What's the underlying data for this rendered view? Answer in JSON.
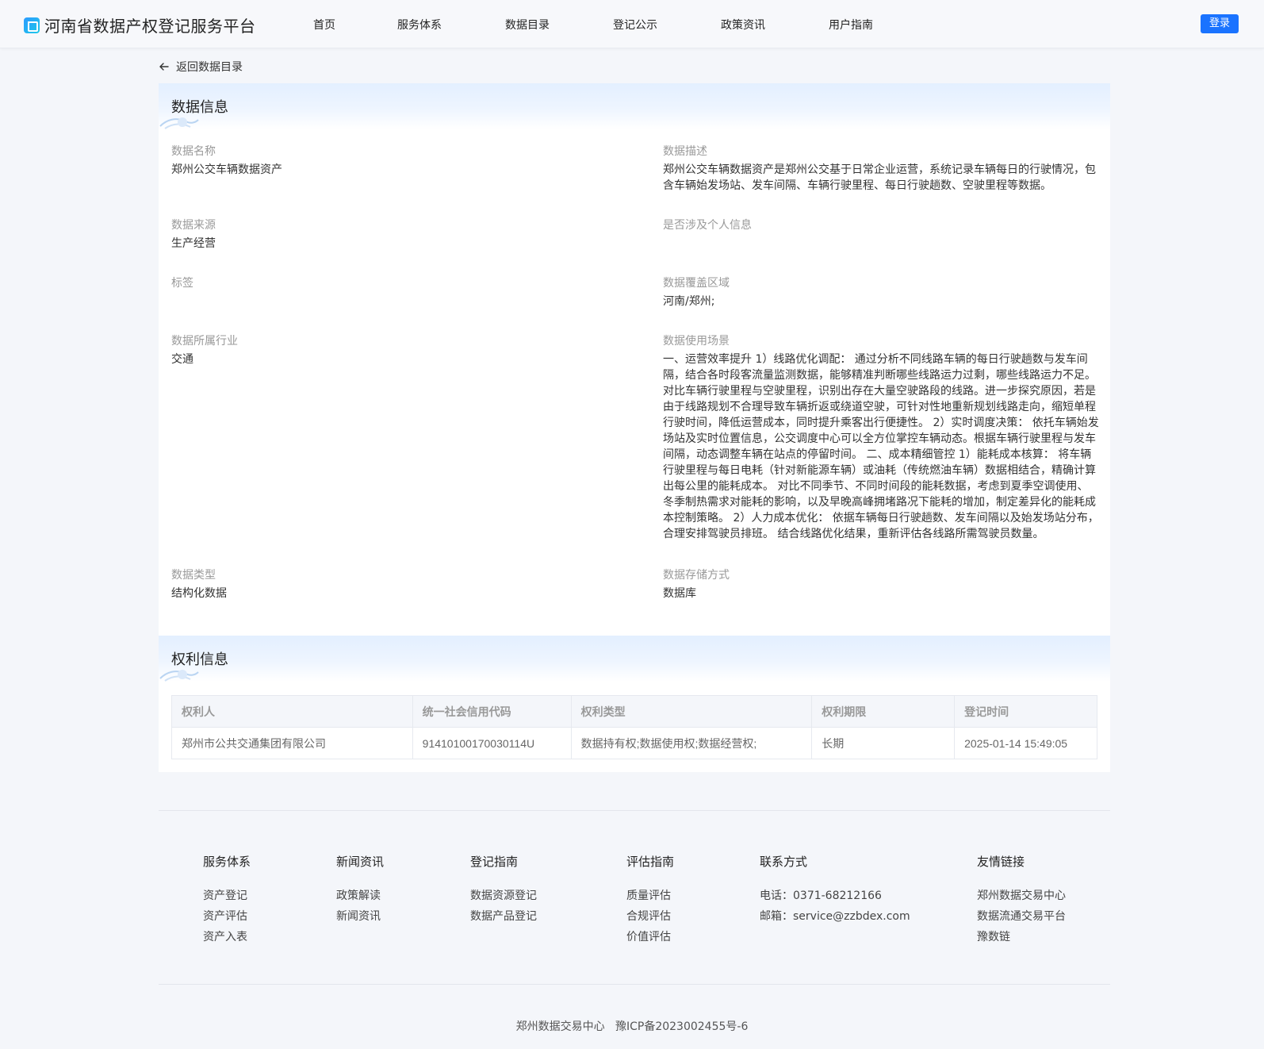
{
  "header": {
    "title": "河南省数据产权登记服务平台",
    "nav": [
      "首页",
      "服务体系",
      "数据目录",
      "登记公示",
      "政策资讯",
      "用户指南"
    ],
    "login_label": "登录"
  },
  "back_label": "返回数据目录",
  "data_info": {
    "section_title": "数据信息",
    "name_label": "数据名称",
    "name_value": "郑州公交车辆数据资产",
    "desc_label": "数据描述",
    "desc_value": "郑州公交车辆数据资产是郑州公交基于日常企业运营，系统记录车辆每日的行驶情况，包含车辆始发场站、发车间隔、车辆行驶里程、每日行驶趟数、空驶里程等数据。",
    "source_label": "数据来源",
    "source_value": "生产经营",
    "personal_label": "是否涉及个人信息",
    "personal_value": "",
    "tag_label": "标签",
    "tag_value": "",
    "region_label": "数据覆盖区域",
    "region_value": "河南/郑州;",
    "industry_label": "数据所属行业",
    "industry_value": "交通",
    "scene_label": "数据使用场景",
    "scene_value": "一、运营效率提升 1）线路优化调配： 通过分析不同线路车辆的每日行驶趟数与发车间隔，结合各时段客流量监测数据，能够精准判断哪些线路运力过剩，哪些线路运力不足。对比车辆行驶里程与空驶里程，识别出存在大量空驶路段的线路。进一步探究原因，若是由于线路规划不合理导致车辆折返或绕道空驶，可针对性地重新规划线路走向，缩短单程行驶时间，降低运营成本，同时提升乘客出行便捷性。 2）实时调度决策： 依托车辆始发场站及实时位置信息，公交调度中心可以全方位掌控车辆动态。根据车辆行驶里程与发车间隔，动态调整车辆在站点的停留时间。 二、成本精细管控 1）能耗成本核算： 将车辆行驶里程与每日电耗（针对新能源车辆）或油耗（传统燃油车辆）数据相结合，精确计算出每公里的能耗成本。 对比不同季节、不同时间段的能耗数据，考虑到夏季空调使用、冬季制热需求对能耗的影响，以及早晚高峰拥堵路况下能耗的增加，制定差异化的能耗成本控制策略。 2）人力成本优化： 依据车辆每日行驶趟数、发车间隔以及始发场站分布，合理安排驾驶员排班。 结合线路优化结果，重新评估各线路所需驾驶员数量。",
    "type_label": "数据类型",
    "type_value": "结构化数据",
    "storage_label": "数据存储方式",
    "storage_value": "数据库"
  },
  "rights_info": {
    "section_title": "权利信息",
    "columns": [
      "权利人",
      "统一社会信用代码",
      "权利类型",
      "权利期限",
      "登记时间"
    ],
    "rows": [
      [
        "郑州市公共交通集团有限公司",
        "91410100170030114U",
        "数据持有权;数据使用权;数据经营权;",
        "长期",
        "2025-01-14 15:49:05"
      ]
    ]
  },
  "footer": {
    "columns": [
      {
        "title": "服务体系",
        "links": [
          "资产登记",
          "资产评估",
          "资产入表"
        ]
      },
      {
        "title": "新闻资讯",
        "links": [
          "政策解读",
          "新闻资讯"
        ]
      },
      {
        "title": "登记指南",
        "links": [
          "数据资源登记",
          "数据产品登记"
        ]
      },
      {
        "title": "评估指南",
        "links": [
          "质量评估",
          "合规评估",
          "价值评估"
        ]
      },
      {
        "title": "联系方式",
        "links": [
          "电话：0371-68212166",
          "邮箱：service@zzbdex.com"
        ]
      },
      {
        "title": "友情链接",
        "links": [
          "郑州数据交易中心",
          "数据流通交易平台",
          "豫数链"
        ]
      }
    ],
    "copyright_org": "郑州数据交易中心",
    "icp": "豫ICP备2023002455号-6"
  }
}
